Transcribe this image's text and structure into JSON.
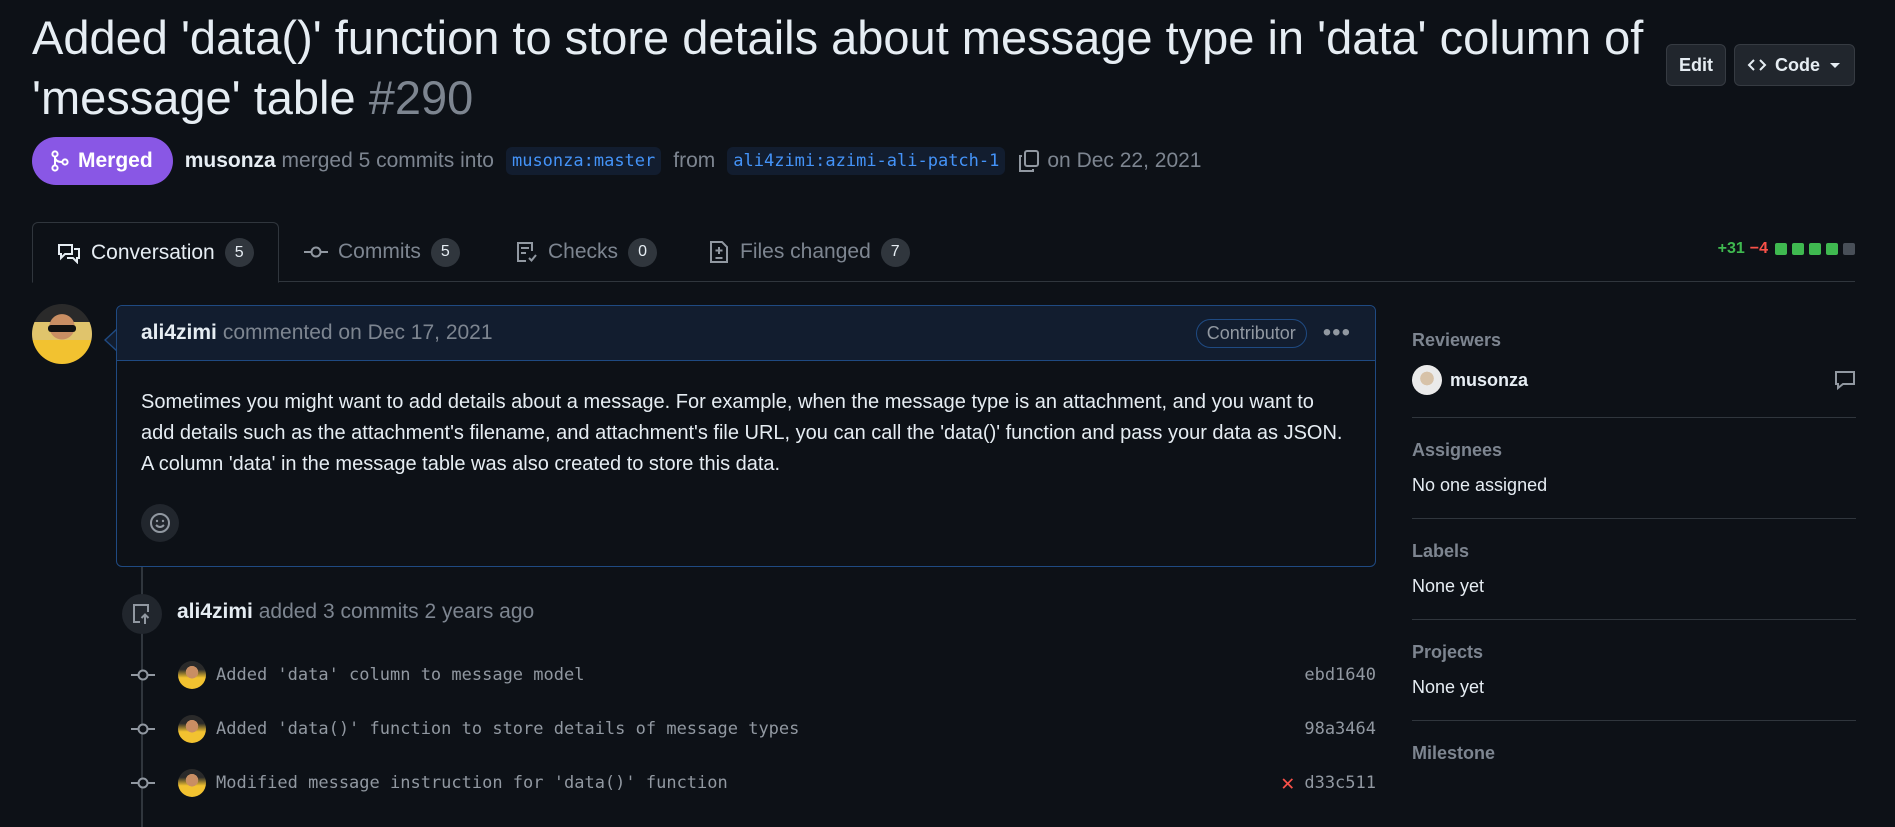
{
  "pr": {
    "title": "Added 'data()' function to store details about message type in 'data' column of 'message' table",
    "number": "#290",
    "state": "Merged",
    "merged_by": "musonza",
    "merge_text": "merged 5 commits into",
    "base_branch": "musonza:master",
    "from_text": "from",
    "head_branch": "ali4zimi:azimi-ali-patch-1",
    "date_text": "on Dec 22, 2021"
  },
  "header_actions": {
    "edit": "Edit",
    "code": "Code"
  },
  "tabs": [
    {
      "label": "Conversation",
      "count": "5"
    },
    {
      "label": "Commits",
      "count": "5"
    },
    {
      "label": "Checks",
      "count": "0"
    },
    {
      "label": "Files changed",
      "count": "7"
    }
  ],
  "diffstat": {
    "additions": "+31",
    "deletions": "−4"
  },
  "comment": {
    "author": "ali4zimi",
    "meta": "commented on Dec 17, 2021",
    "role": "Contributor",
    "body": "Sometimes you might want to add details about a message. For example, when the message type is an attachment, and you want to add details such as the attachment's filename, and attachment's file URL, you can call the 'data()' function and pass your data as JSON. A column 'data' in the message table was also created to store this data."
  },
  "push_event": {
    "author": "ali4zimi",
    "text": "added 3 commits 2 years ago"
  },
  "commits": [
    {
      "message": "Added 'data' column to message model",
      "sha": "ebd1640",
      "status": ""
    },
    {
      "message": "Added 'data()' function to store details of message types",
      "sha": "98a3464",
      "status": ""
    },
    {
      "message": "Modified message instruction for 'data()' function",
      "sha": "d33c511",
      "status": "failed"
    }
  ],
  "sidebar": {
    "reviewers": {
      "heading": "Reviewers",
      "name": "musonza"
    },
    "assignees": {
      "heading": "Assignees",
      "value": "No one assigned"
    },
    "labels": {
      "heading": "Labels",
      "value": "None yet"
    },
    "projects": {
      "heading": "Projects",
      "value": "None yet"
    },
    "milestone": {
      "heading": "Milestone"
    }
  },
  "colors": {
    "background": "#0d1117",
    "merged": "#8957e5",
    "accent_blue": "#4493f8",
    "add_green": "#3fb950",
    "del_red": "#f85149"
  }
}
